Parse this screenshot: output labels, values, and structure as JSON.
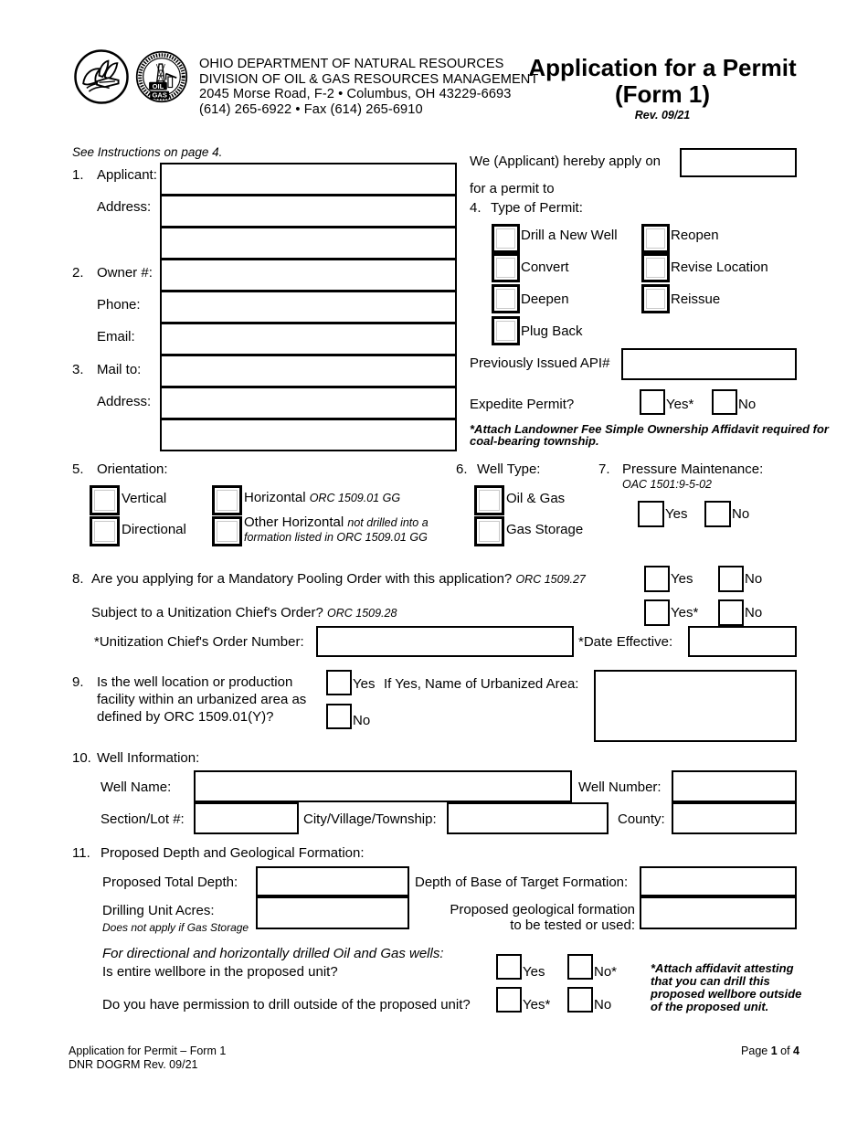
{
  "header": {
    "agency_line1": "OHIO DEPARTMENT OF NATURAL RESOURCES",
    "agency_line2": "DIVISION OF OIL & GAS RESOURCES MANAGEMENT",
    "agency_line3": "2045 Morse Road, F-2 • Columbus, OH 43229-6693",
    "agency_line4": "(614) 265-6922 • Fax (614) 265-6910",
    "title_line1": "Application for a Permit",
    "title_line2": "(Form 1)",
    "revision": "Rev. 09/21",
    "logo_odnr_name": "odnr-leaf-hand-logo",
    "logo_oilgas_name": "oil-and-gas-seal-logo"
  },
  "instructions_note": "See Instructions on page 4.",
  "applicant": {
    "n1": "1.",
    "label_applicant": "Applicant:",
    "label_address": "Address:",
    "value_applicant": "",
    "value_address1": "",
    "value_address2": ""
  },
  "owner": {
    "n2": "2.",
    "label_owner": "Owner #:",
    "label_phone": "Phone:",
    "label_email": "Email:",
    "value_owner": "",
    "value_phone": "",
    "value_email": ""
  },
  "mailto": {
    "n3": "3.",
    "label_mailto": "Mail to:",
    "label_address": "Address:",
    "value_mailto": "",
    "value_address1": "",
    "value_address2": ""
  },
  "apply": {
    "line1": "We (Applicant) hereby apply on",
    "line2": "for a permit to",
    "date_value": ""
  },
  "permit_type": {
    "n4": "4.",
    "heading": "Type of Permit:",
    "options_left": [
      "Drill a New Well",
      "Convert",
      "Deepen",
      "Plug Back"
    ],
    "options_right": [
      "Reopen",
      "Revise Location",
      "Reissue"
    ],
    "api_label": "Previously Issued API#",
    "api_value": ""
  },
  "expedite": {
    "label": "Expedite Permit?",
    "yes": "Yes*",
    "no": "No",
    "footnote_line1": "*Attach Landowner Fee Simple Ownership Affidavit required for",
    "footnote_line2": "coal-bearing township."
  },
  "orientation": {
    "n5": "5.",
    "heading": "Orientation:",
    "vertical": "Vertical",
    "directional": "Directional",
    "horizontal": "Horizontal",
    "horizontal_cite": "ORC 1509.01 GG",
    "other_horizontal": "Other Horizontal",
    "other_horizontal_note1": "not drilled into a",
    "other_horizontal_note2": "formation listed in ORC 1509.01 GG"
  },
  "well_type": {
    "n6": "6.",
    "heading": "Well Type:",
    "oil_gas": "Oil & Gas",
    "gas_storage": "Gas Storage"
  },
  "pressure": {
    "n7": "7.",
    "heading": "Pressure Maintenance:",
    "cite": "OAC 1501:9-5-02",
    "yes": "Yes",
    "no": "No"
  },
  "pooling": {
    "n8": "8.",
    "q1": "Are you applying for a Mandatory Pooling Order with this application?",
    "q1_cite": "ORC 1509.27",
    "q1_yes": "Yes",
    "q1_no": "No",
    "q2": "Subject to a Unitization Chief's Order?",
    "q2_cite": "ORC 1509.28",
    "q2_yes": "Yes*",
    "q2_no": "No",
    "order_number_label": "*Unitization Chief's Order Number:",
    "order_number_value": "",
    "date_effective_label": "*Date Effective:",
    "date_effective_value": ""
  },
  "urbanized": {
    "n9": "9.",
    "q_line1": "Is the well location or production",
    "q_line2": "facility within an urbanized area as",
    "q_line3": "defined by ORC 1509.01(Y)?",
    "yes": "Yes",
    "no": "No",
    "if_yes_label": "If Yes, Name of Urbanized Area:",
    "area_value": ""
  },
  "well_info": {
    "n10": "10.",
    "heading": "Well Information:",
    "well_name_label": "Well Name:",
    "well_name_value": "",
    "well_number_label": "Well Number:",
    "well_number_value": "",
    "section_lot_label": "Section/Lot #:",
    "section_lot_value": "",
    "city_label": "City/Village/Township:",
    "city_value": "",
    "county_label": "County:",
    "county_value": ""
  },
  "depth": {
    "n11": "11.",
    "heading": "Proposed Depth and Geological Formation:",
    "total_depth_label": "Proposed Total Depth:",
    "total_depth_value": "",
    "base_target_label": "Depth of Base of Target Formation:",
    "base_target_value": "",
    "drilling_unit_label": "Drilling Unit Acres:",
    "drilling_unit_note": "Does not apply if Gas Storage",
    "drilling_unit_value": "",
    "geo_formation_line1": "Proposed geological formation",
    "geo_formation_line2": "to be tested or used:",
    "geo_formation_value": ""
  },
  "directional": {
    "heading": "For directional and horizontally drilled Oil and Gas wells:",
    "q1": "Is entire wellbore in the proposed unit?",
    "q1_yes": "Yes",
    "q1_no": "No*",
    "q2": "Do you have permission to drill outside of the proposed unit?",
    "q2_yes": "Yes*",
    "q2_no": "No",
    "note_line1": "*Attach affidavit attesting",
    "note_line2": "that you can drill this",
    "note_line3": "proposed wellbore outside",
    "note_line4": "of the proposed unit."
  },
  "footer": {
    "left_line1": "Application for Permit – Form 1",
    "left_line2": "DNR DOGRM  Rev. 09/21",
    "page_prefix": "Page ",
    "page_number": "1",
    "page_suffix": " of ",
    "page_total": "4"
  }
}
